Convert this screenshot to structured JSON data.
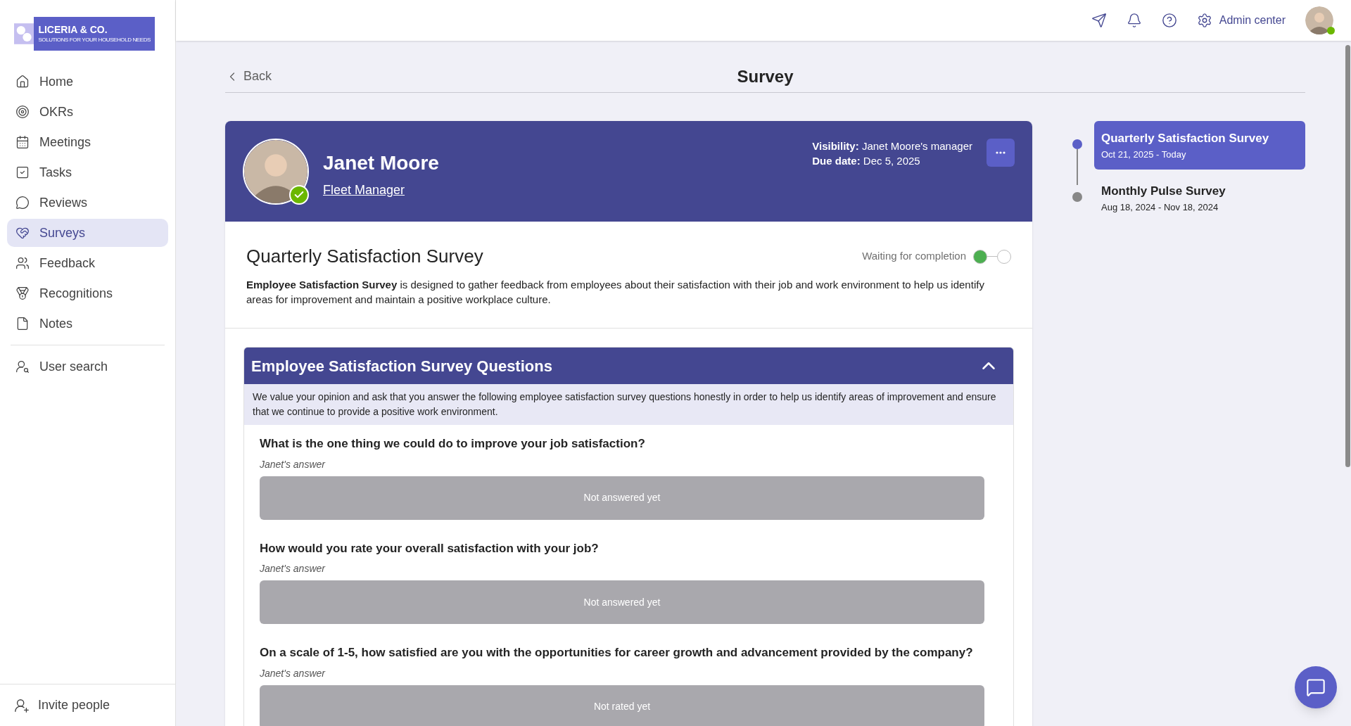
{
  "logo": {
    "name": "LICERIA & CO.",
    "tagline": "SOLUTIONS FOR YOUR HOUSEHOLD NEEDS"
  },
  "sidebar": {
    "items": [
      {
        "label": "Home",
        "selected": false
      },
      {
        "label": "OKRs",
        "selected": false
      },
      {
        "label": "Meetings",
        "selected": false
      },
      {
        "label": "Tasks",
        "selected": false
      },
      {
        "label": "Reviews",
        "selected": false
      },
      {
        "label": "Surveys",
        "selected": true
      },
      {
        "label": "Feedback",
        "selected": false
      },
      {
        "label": "Recognitions",
        "selected": false
      },
      {
        "label": "Notes",
        "selected": false
      }
    ],
    "search": "User search",
    "invite": "Invite people"
  },
  "topbar": {
    "admin": "Admin center",
    "online": true
  },
  "page": {
    "back": "Back",
    "title": "Survey"
  },
  "person": {
    "name": "Janet Moore",
    "role": "Fleet Manager",
    "verified": true,
    "visibility_label": "Visibility:",
    "visibility": "Janet Moore's manager",
    "due_label": "Due date:",
    "due": "Dec 5, 2025"
  },
  "survey": {
    "title": "Quarterly Satisfaction Survey",
    "description": "**Employee Satisfaction Survey** is designed to gather feedback from employees about their satisfaction with their job and work environment to help us identify areas for improvement and maintain a positive workplace culture.",
    "status": "Waiting for completion",
    "steps": [
      {
        "completed": true
      },
      {
        "completed": false
      }
    ]
  },
  "section": {
    "title": "Employee Satisfaction Survey Questions",
    "expanded": true,
    "intro": "We value your opinion and ask that you answer the following employee satisfaction survey questions honestly in order to help us identify areas of improvement and ensure that we continue to provide a positive work environment.",
    "questions": [
      {
        "text": "What is the one thing we could do to improve your job satisfaction?",
        "answer_label": "Janet's answer",
        "answer": "Not answered yet"
      },
      {
        "text": "How would you rate your overall satisfaction with your job?",
        "answer_label": "Janet's answer",
        "answer": "Not answered yet"
      },
      {
        "text": "On a scale of 1-5, how satisfied are you with the opportunities for career growth and advancement provided by the company?",
        "answer_label": "Janet's answer",
        "answer": "Not rated yet"
      }
    ]
  },
  "timeline": [
    {
      "title": "Quarterly Satisfaction Survey",
      "dates": "Oct 21, 2025 - Today",
      "selected": true
    },
    {
      "title": "Monthly Pulse Survey",
      "dates": "Aug 18, 2024 - Nov 18, 2024",
      "selected": false
    }
  ]
}
